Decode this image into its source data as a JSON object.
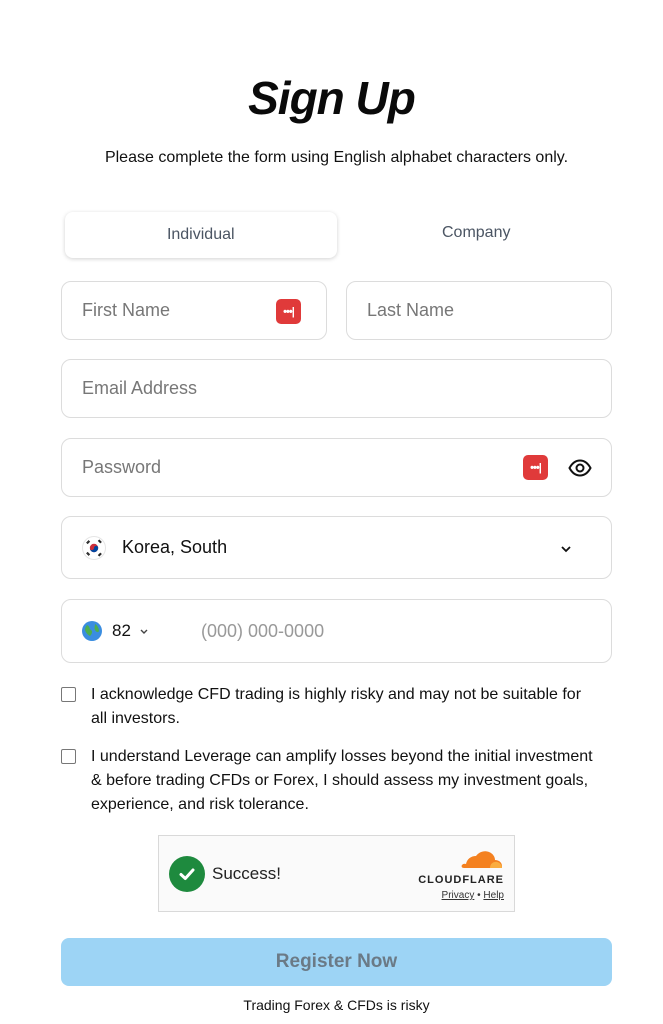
{
  "header": {
    "title": "Sign Up",
    "subtitle": "Please complete the form using English alphabet characters only."
  },
  "tabs": [
    {
      "label": "Individual",
      "active": true
    },
    {
      "label": "Company",
      "active": false
    }
  ],
  "form": {
    "first_name_placeholder": "First Name",
    "last_name_placeholder": "Last Name",
    "email_placeholder": "Email Address",
    "password_placeholder": "Password",
    "country_value": "Korea, South",
    "phone_code": "82",
    "phone_placeholder": "(000) 000-0000",
    "password_manager_badge": "•••|"
  },
  "checkboxes": [
    {
      "label": "I acknowledge CFD trading is highly risky and may not be suitable for all investors.",
      "checked": false
    },
    {
      "label": "I understand Leverage can amplify losses beyond the initial investment & before trading CFDs or Forex, I should assess my investment goals, experience, and risk tolerance.",
      "checked": false
    }
  ],
  "captcha": {
    "status": "Success!",
    "brand": "CLOUDFLARE",
    "privacy": "Privacy",
    "separator": "•",
    "help": "Help"
  },
  "register_label": "Register Now",
  "footer_text": "Trading Forex & CFDs is risky",
  "colors": {
    "accent_button": "#9dd4f5",
    "password_badge": "#e03a3a",
    "success_green": "#1e8a3e",
    "cloudflare_orange": "#f48120"
  }
}
